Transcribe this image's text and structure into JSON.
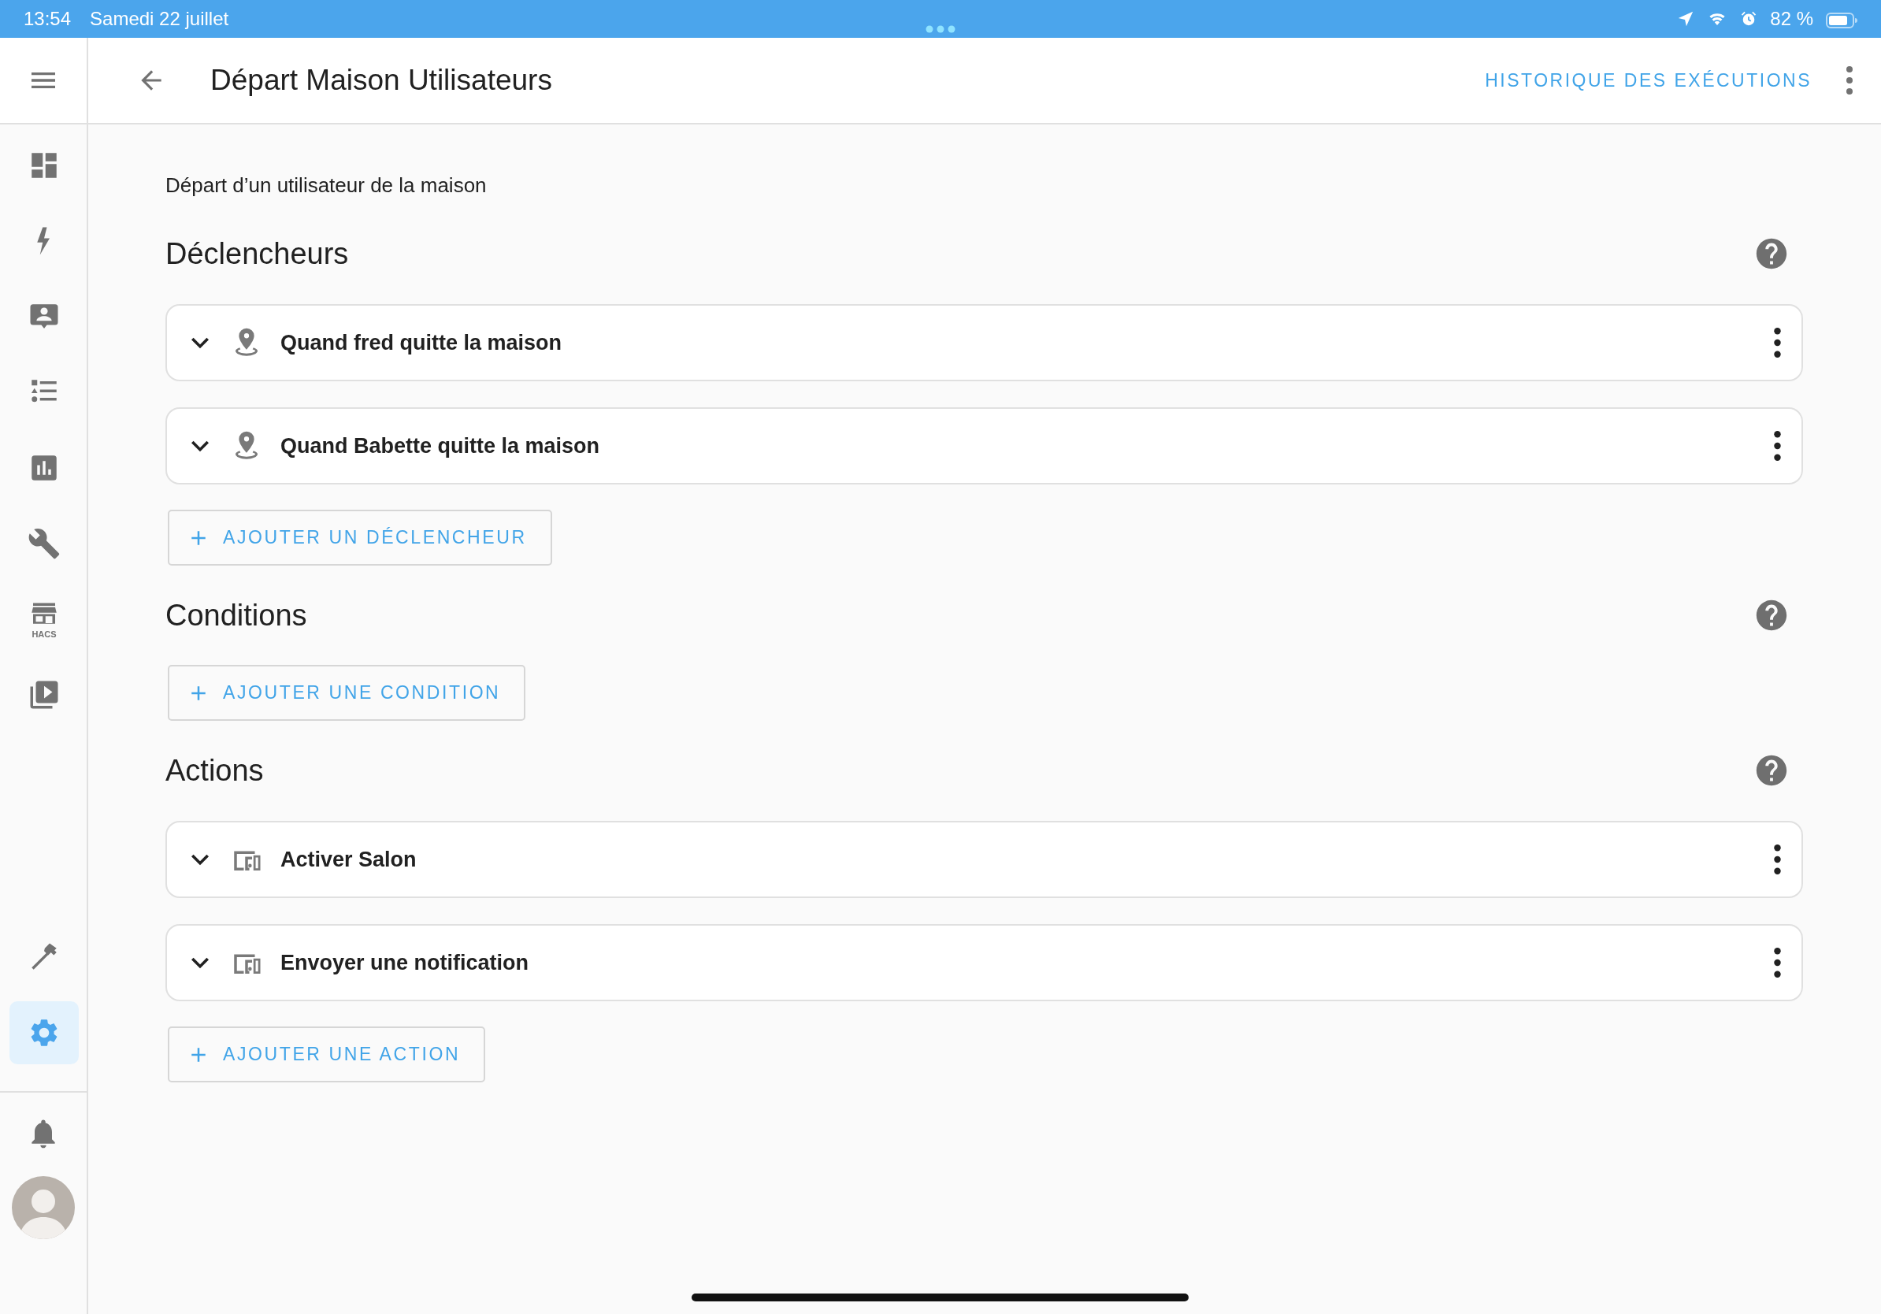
{
  "status_bar": {
    "time": "13:54",
    "date": "Samedi 22 juillet",
    "battery": "82 %"
  },
  "sidebar": {
    "items": [
      {
        "kind": "dashboard",
        "selected": false
      },
      {
        "kind": "energy",
        "selected": false
      },
      {
        "kind": "person",
        "selected": false
      },
      {
        "kind": "list",
        "selected": false
      },
      {
        "kind": "chart",
        "selected": false
      },
      {
        "kind": "wrench",
        "selected": false
      },
      {
        "kind": "store",
        "label": "HACS",
        "selected": false
      },
      {
        "kind": "media",
        "selected": false
      }
    ],
    "bottom_items": [
      {
        "kind": "hammer",
        "selected": false
      },
      {
        "kind": "settings",
        "selected": true
      }
    ]
  },
  "header": {
    "title": "Départ Maison Utilisateurs",
    "history_link": "HISTORIQUE DES EXÉCUTIONS"
  },
  "description": "Départ d’un utilisateur de la maison",
  "sections": [
    {
      "title": "Déclencheurs",
      "items": [
        {
          "kind": "location",
          "label": "Quand fred quitte la maison"
        },
        {
          "kind": "location",
          "label": "Quand Babette quitte la maison"
        }
      ],
      "add_button": "AJOUTER UN DÉCLENCHEUR"
    },
    {
      "title": "Conditions",
      "add_button": "AJOUTER UNE CONDITION"
    },
    {
      "title": "Actions",
      "items": [
        {
          "kind": "device",
          "label": "Activer Salon"
        },
        {
          "kind": "device",
          "label": "Envoyer une notification"
        }
      ],
      "add_button": "AJOUTER UNE ACTION"
    }
  ]
}
